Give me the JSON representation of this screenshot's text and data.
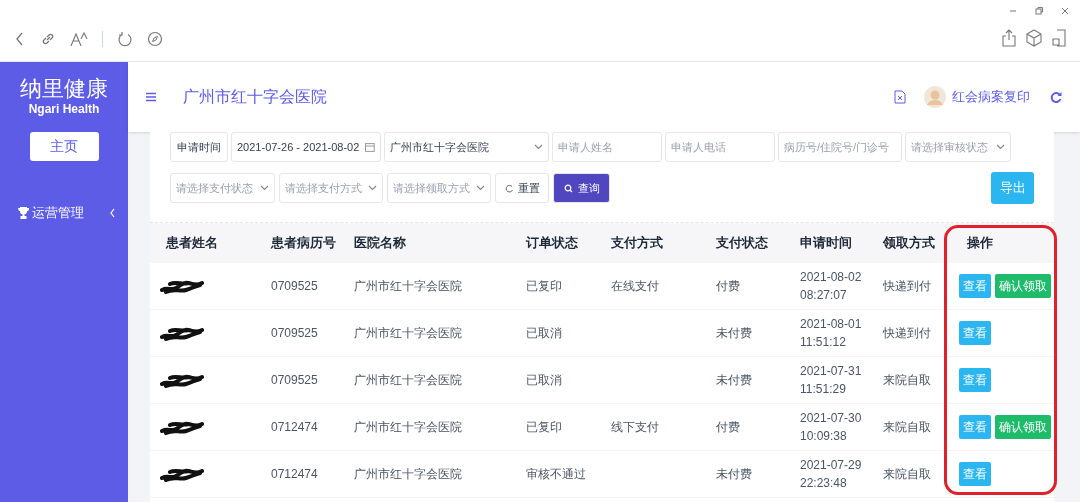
{
  "sidebar": {
    "logo_cn": "纳里健康",
    "logo_en": "Ngari Health",
    "home_button": "主页",
    "items": [
      {
        "label": "运营管理",
        "expanded": false
      }
    ]
  },
  "header": {
    "title": "广州市红十字会医院",
    "user": "红会病案复印"
  },
  "filters": {
    "row_1": [
      {
        "kind": "label",
        "text": "申请时间"
      },
      {
        "kind": "date",
        "value": "2021-07-26 - 2021-08-02"
      },
      {
        "kind": "select",
        "value": "广州市红十字会医院"
      },
      {
        "kind": "input",
        "placeholder": "申请人姓名"
      },
      {
        "kind": "input",
        "placeholder": "申请人电话"
      },
      {
        "kind": "input",
        "placeholder": "病历号/住院号/门诊号"
      },
      {
        "kind": "select",
        "placeholder": "请选择审核状态"
      }
    ],
    "row_2": [
      {
        "kind": "select",
        "placeholder": "请选择支付状态"
      },
      {
        "kind": "select",
        "placeholder": "请选择支付方式"
      },
      {
        "kind": "select",
        "placeholder": "请选择领取方式"
      },
      {
        "kind": "reset",
        "text": "重置"
      },
      {
        "kind": "search",
        "text": "查询"
      }
    ],
    "export_button": "导出"
  },
  "table": {
    "columns": [
      "患者姓名",
      "患者病历号",
      "医院名称",
      "订单状态",
      "支付方式",
      "支付状态",
      "申请时间",
      "领取方式",
      "操作"
    ],
    "rows": [
      {
        "record_no": "0709525",
        "hospital": "广州市红十字会医院",
        "order_status": "已复印",
        "pay_method": "在线支付",
        "pay_status": "付费",
        "date": "2021-08-02",
        "time": "08:27:07",
        "pickup": "快递到付",
        "actions": [
          {
            "kind": "view",
            "label": "查看"
          },
          {
            "kind": "confirm",
            "label": "确认领取"
          }
        ]
      },
      {
        "record_no": "0709525",
        "hospital": "广州市红十字会医院",
        "order_status": "已取消",
        "pay_status": "未付费",
        "date": "2021-08-01",
        "time": "11:51:12",
        "pickup": "快递到付",
        "actions": [
          {
            "kind": "view",
            "label": "查看"
          }
        ]
      },
      {
        "record_no": "0709525",
        "hospital": "广州市红十字会医院",
        "order_status": "已取消",
        "pay_status": "未付费",
        "date": "2021-07-31",
        "time": "11:51:29",
        "pickup": "来院自取",
        "actions": [
          {
            "kind": "view",
            "label": "查看"
          }
        ]
      },
      {
        "record_no": "0712474",
        "hospital": "广州市红十字会医院",
        "order_status": "已复印",
        "pay_method": "线下支付",
        "pay_status": "付费",
        "date": "2021-07-30",
        "time": "10:09:38",
        "pickup": "来院自取",
        "actions": [
          {
            "kind": "view",
            "label": "查看"
          },
          {
            "kind": "confirm",
            "label": "确认领取"
          }
        ]
      },
      {
        "record_no": "0712474",
        "hospital": "广州市红十字会医院",
        "order_status": "审核不通过",
        "pay_status": "未付费",
        "date": "2021-07-29",
        "time": "22:23:48",
        "pickup": "来院自取",
        "actions": [
          {
            "kind": "view",
            "label": "查看"
          }
        ]
      }
    ]
  }
}
